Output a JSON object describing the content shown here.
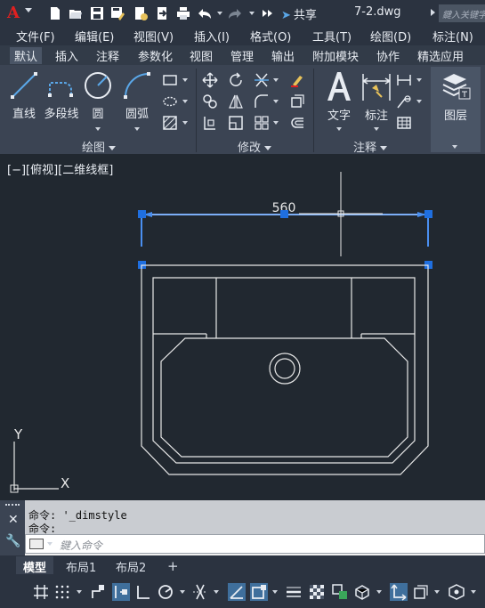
{
  "titlebar": {
    "logo_text": "A",
    "share_label": "共享",
    "filename": "7-2.dwg",
    "search_placeholder": "鍵入关键字"
  },
  "menubar": {
    "items": [
      "文件(F)",
      "编辑(E)",
      "视图(V)",
      "插入(I)",
      "格式(O)",
      "工具(T)",
      "绘图(D)",
      "标注(N)"
    ]
  },
  "ribbon_tabs": {
    "items": [
      "默认",
      "插入",
      "注释",
      "参数化",
      "视图",
      "管理",
      "输出",
      "附加模块",
      "协作",
      "精选应用"
    ],
    "active": "默认"
  },
  "ribbon": {
    "draw_panel": {
      "title": "绘图",
      "tools": [
        "直线",
        "多段线",
        "圆",
        "圆弧"
      ]
    },
    "modify_panel": {
      "title": "修改"
    },
    "annotation_panel": {
      "title": "注释",
      "tools": [
        "文字",
        "标注"
      ]
    },
    "layers_panel": {
      "tools": [
        "图层"
      ]
    }
  },
  "canvas": {
    "viewport_label": "[−][俯视][二维线框]",
    "dimension_text": "560",
    "ucs_x_label": "X",
    "ucs_y_label": "Y"
  },
  "command": {
    "history": [
      "命令: '_dimstyle",
      "命令:"
    ],
    "placeholder": "鍵入命令"
  },
  "layout_tabs": {
    "items": [
      "模型",
      "布局1",
      "布局2"
    ],
    "active": "模型",
    "add_label": "+"
  },
  "colors": {
    "background": "#212830",
    "grip_blue": "#1f6fe0",
    "selected_line": "#4a8ff0",
    "drawing_line": "#e8e8e8",
    "logo_red": "#e02020"
  }
}
